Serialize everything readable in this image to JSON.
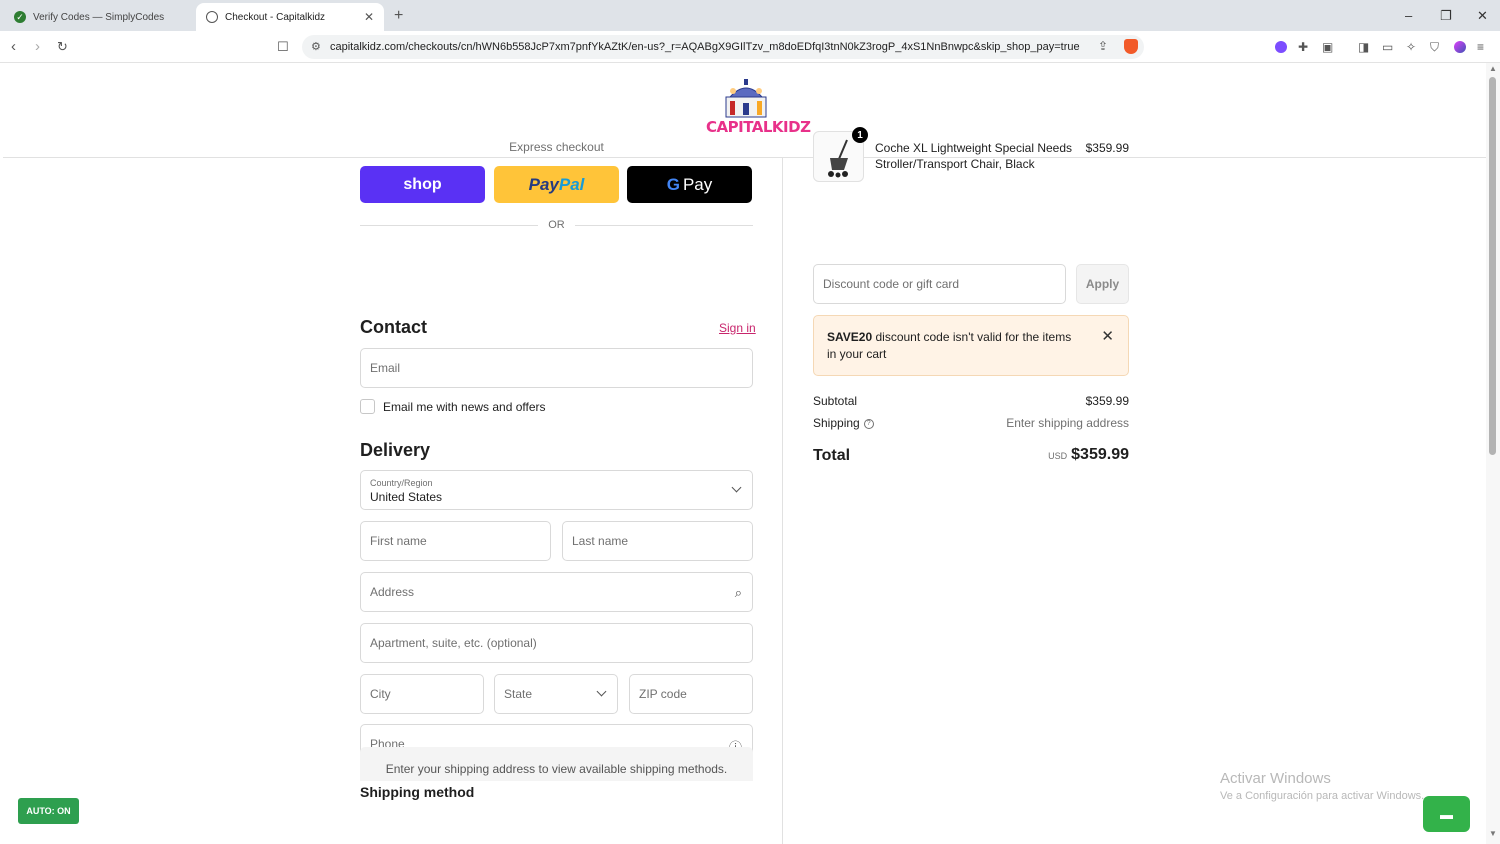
{
  "browser": {
    "tabs": [
      {
        "title": "Verify Codes — SimplyCodes"
      },
      {
        "title": "Checkout - Capitalkidz"
      }
    ],
    "url": "capitalkidz.com/checkouts/cn/hWN6b558JcP7xm7pnfYkAZtK/en-us?_r=AQABgX9GIlTzv_m8doEDfqI3tnN0kZ3rogP_4xS1NnBnwpc&skip_shop_pay=true",
    "icons": {
      "back": "back-arrow-icon",
      "forward": "forward-arrow-icon",
      "reload": "reload-icon",
      "bookmark": "bookmark-icon",
      "share": "share-icon"
    }
  },
  "header": {
    "logo_text": "CAPITALKIDZ"
  },
  "express": {
    "label": "Express checkout",
    "shop_label": "shop",
    "paypal_label_a": "Pay",
    "paypal_label_b": "Pal",
    "gpay_label_g": "G",
    "gpay_label": "Pay",
    "or_label": "OR"
  },
  "contact": {
    "title": "Contact",
    "sign_in": "Sign in",
    "email_placeholder": "Email",
    "newsletter_label": "Email me with news and offers"
  },
  "delivery": {
    "title": "Delivery",
    "country_label": "Country/Region",
    "country_value": "United States",
    "first_name_placeholder": "First name",
    "last_name_placeholder": "Last name",
    "address_placeholder": "Address",
    "apartment_placeholder": "Apartment, suite, etc. (optional)",
    "city_placeholder": "City",
    "state_label": "State",
    "zip_placeholder": "ZIP code",
    "phone_placeholder": "Phone"
  },
  "shipping_method": {
    "title": "Shipping method",
    "message": "Enter your shipping address to view available shipping methods."
  },
  "summary": {
    "item": {
      "quantity": "1",
      "name": "Coche XL Lightweight Special Needs Stroller/Transport Chair, Black",
      "price": "$359.99"
    },
    "discount_placeholder": "Discount code or gift card",
    "apply_label": "Apply",
    "alert_code": "SAVE20",
    "alert_text": " discount code isn't valid for the items in your cart",
    "subtotal_label": "Subtotal",
    "subtotal_value": "$359.99",
    "shipping_label": "Shipping",
    "shipping_value": "Enter shipping address",
    "total_label": "Total",
    "total_currency": "USD",
    "total_value": "$359.99"
  },
  "overlays": {
    "auto_label": "AUTO: ON",
    "watermark_title": "Activar Windows",
    "watermark_sub": "Ve a Configuración para activar Windows."
  },
  "colors": {
    "shop_pay": "#5a31f4",
    "paypal": "#ffc439",
    "accent_link": "#c8256c",
    "alert_bg": "#fff3e6",
    "auto_green": "#2e9f4f"
  }
}
